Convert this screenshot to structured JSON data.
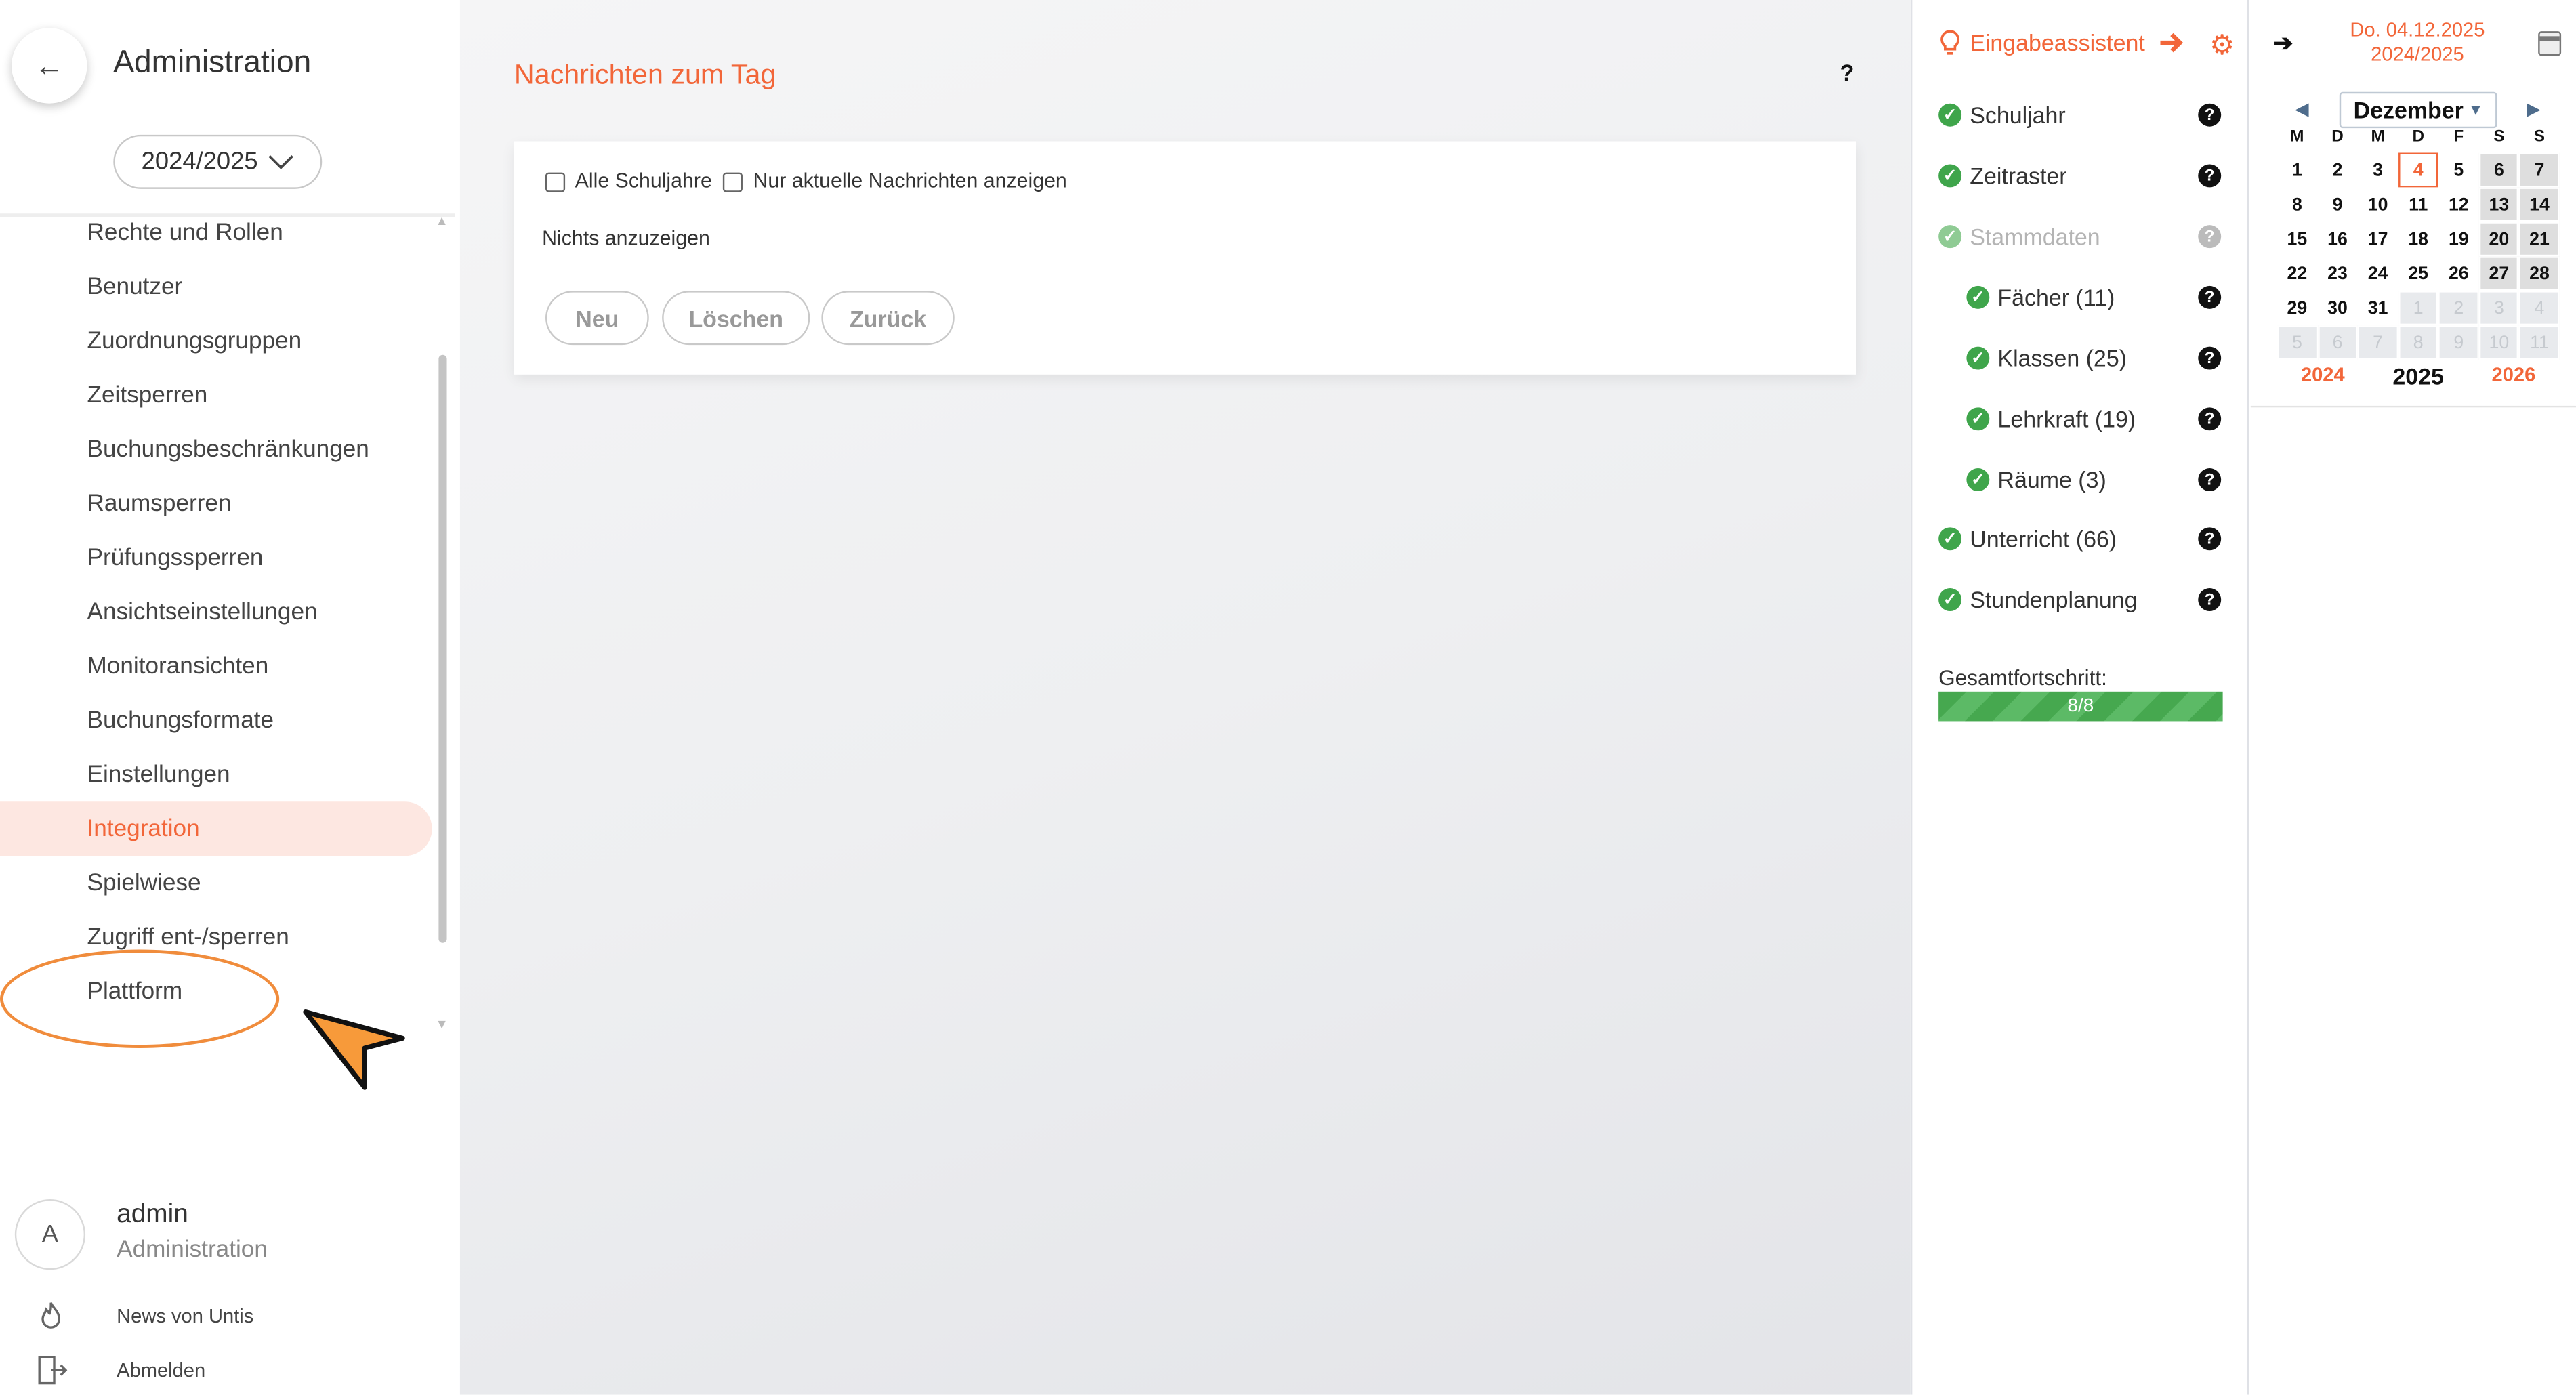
{
  "sidebar": {
    "back_icon": "←",
    "title": "Administration",
    "year_select": "2024/2025",
    "menu": [
      {
        "label": "Rechte und Rollen"
      },
      {
        "label": "Benutzer"
      },
      {
        "label": "Zuordnungsgruppen"
      },
      {
        "label": "Zeitsperren"
      },
      {
        "label": "Buchungsbeschränkungen"
      },
      {
        "label": "Raumsperren"
      },
      {
        "label": "Prüfungssperren"
      },
      {
        "label": "Ansichtseinstellungen"
      },
      {
        "label": "Monitoransichten"
      },
      {
        "label": "Buchungsformate"
      },
      {
        "label": "Einstellungen"
      },
      {
        "label": "Integration",
        "active": true
      },
      {
        "label": "Spielwiese"
      },
      {
        "label": "Zugriff ent-/sperren"
      },
      {
        "label": "Plattform"
      }
    ],
    "user": {
      "initial": "A",
      "name": "admin",
      "role": "Administration"
    },
    "footer": [
      {
        "label": "News von Untis",
        "icon": "flame-icon"
      },
      {
        "label": "Abmelden",
        "icon": "logout-icon"
      }
    ]
  },
  "main": {
    "title": "Nachrichten zum Tag",
    "help": "?",
    "checkbox_all_years": "Alle Schuljahre",
    "checkbox_current_only": "Nur aktuelle Nachrichten anzeigen",
    "empty_text": "Nichts anzuzeigen",
    "buttons": {
      "new": "Neu",
      "delete": "Löschen",
      "back": "Zurück"
    }
  },
  "wizard": {
    "title": "Eingabeassistent",
    "items": [
      {
        "label": "Schuljahr"
      },
      {
        "label": "Zeitraster"
      },
      {
        "label": "Stammdaten",
        "dim": true
      },
      {
        "label": "Fächer (11)"
      },
      {
        "label": "Klassen (25)"
      },
      {
        "label": "Lehrkraft (19)"
      },
      {
        "label": "Räume (3)"
      },
      {
        "label": "Unterricht (66)"
      },
      {
        "label": "Stundenplanung"
      }
    ],
    "progress_label": "Gesamtfortschritt:",
    "progress_text": "8/8",
    "progress_fraction": 1.0
  },
  "calendar": {
    "date_line1": "Do. 04.12.2025",
    "date_line2": "2024/2025",
    "month": "Dezember",
    "weekday_headers": [
      "M",
      "D",
      "M",
      "D",
      "F",
      "S",
      "S"
    ],
    "weeks": [
      [
        "1",
        "2",
        "3",
        "4",
        "5",
        "6",
        "7"
      ],
      [
        "8",
        "9",
        "10",
        "11",
        "12",
        "13",
        "14"
      ],
      [
        "15",
        "16",
        "17",
        "18",
        "19",
        "20",
        "21"
      ],
      [
        "22",
        "23",
        "24",
        "25",
        "26",
        "27",
        "28"
      ],
      [
        "29",
        "30",
        "31",
        "1",
        "2",
        "3",
        "4"
      ],
      [
        "5",
        "6",
        "7",
        "8",
        "9",
        "10",
        "11"
      ]
    ],
    "today": "4",
    "years": [
      "2024",
      "2025",
      "2026"
    ],
    "current_year": "2025"
  },
  "colors": {
    "accent": "#f26639",
    "success": "#3fa54b",
    "annotation": "#f08c3c"
  }
}
